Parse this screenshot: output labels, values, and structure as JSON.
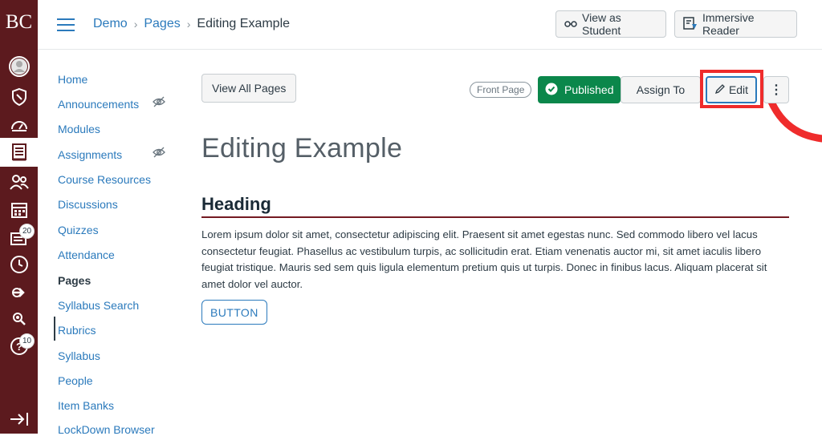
{
  "global_nav": {
    "logo": "BC",
    "badges": {
      "inbox": "20",
      "help": "10"
    },
    "items": [
      "account-icon",
      "admin-icon",
      "dashboard-icon",
      "courses-icon",
      "groups-icon",
      "calendar-icon",
      "inbox-icon",
      "history-icon",
      "commons-icon",
      "studio-icon",
      "help-icon",
      "collapse-icon"
    ]
  },
  "breadcrumb": {
    "course": "Demo",
    "section": "Pages",
    "current": "Editing Example"
  },
  "top_actions": {
    "view_student": "View as Student",
    "immersive": "Immersive Reader"
  },
  "course_nav": {
    "items": [
      "Home",
      "Announcements",
      "Modules",
      "Assignments",
      "Course Resources",
      "Discussions",
      "Quizzes",
      "Attendance",
      "Pages",
      "Syllabus Search",
      "Rubrics",
      "Syllabus",
      "People",
      "Item Banks",
      "LockDown Browser"
    ],
    "active": "Pages"
  },
  "page_actions": {
    "view_all": "View All Pages",
    "front_page": "Front Page",
    "published": "Published",
    "assign_to": "Assign To",
    "edit": "Edit",
    "more": "⋮"
  },
  "page": {
    "title": "Editing Example",
    "heading": "Heading",
    "body": "Lorem ipsum dolor sit amet, consectetur adipiscing elit. Praesent sit amet egestas nunc. Sed commodo libero vel lacus consectetur feugiat. Phasellus ac vestibulum turpis, ac sollicitudin erat. Etiam venenatis auctor mi, sit amet iaculis libero feugiat tristique. Mauris sed sem quis ligula elementum pretium quis ut turpis. Donec in finibus lacus. Aliquam placerat sit amet dolor vel auctor.",
    "button": "BUTTON"
  },
  "colors": {
    "nav": "#5c1a1e",
    "link": "#2b7abc",
    "published": "#0b874b",
    "annotation": "#ef2c2c",
    "heading_rule": "#741a22"
  }
}
